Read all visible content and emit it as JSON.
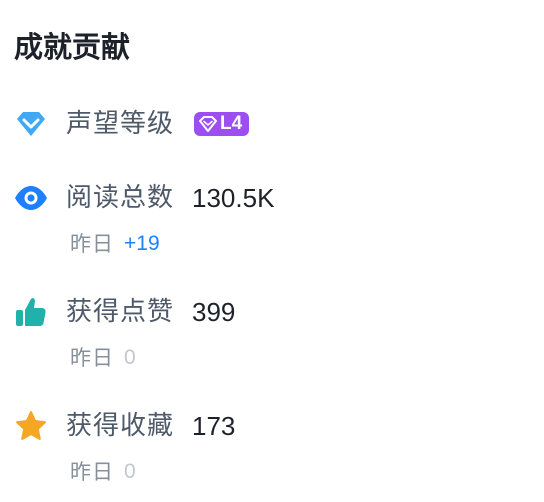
{
  "title": "成就贡献",
  "colors": {
    "reputation_icon": "#3fa9f5",
    "reputation_badge": "#9c4ef0",
    "read_icon": "#1e80ff",
    "like_icon": "#20b2aa",
    "collect_icon": "#f5a623",
    "increase_text": "#1e80ff",
    "zero_text": "#c2c7cf"
  },
  "reputation": {
    "label": "声望等级",
    "icon": "diamond-icon",
    "level": "L4"
  },
  "stats": [
    {
      "key": "reads",
      "icon": "eye-icon",
      "label": "阅读总数",
      "value": "130.5K",
      "yesterday_label": "昨日",
      "yesterday_value": "+19"
    },
    {
      "key": "likes",
      "icon": "thumbs-up-icon",
      "label": "获得点赞",
      "value": "399",
      "yesterday_label": "昨日",
      "yesterday_value": "0"
    },
    {
      "key": "collects",
      "icon": "star-icon",
      "label": "获得收藏",
      "value": "173",
      "yesterday_label": "昨日",
      "yesterday_value": "0"
    }
  ]
}
